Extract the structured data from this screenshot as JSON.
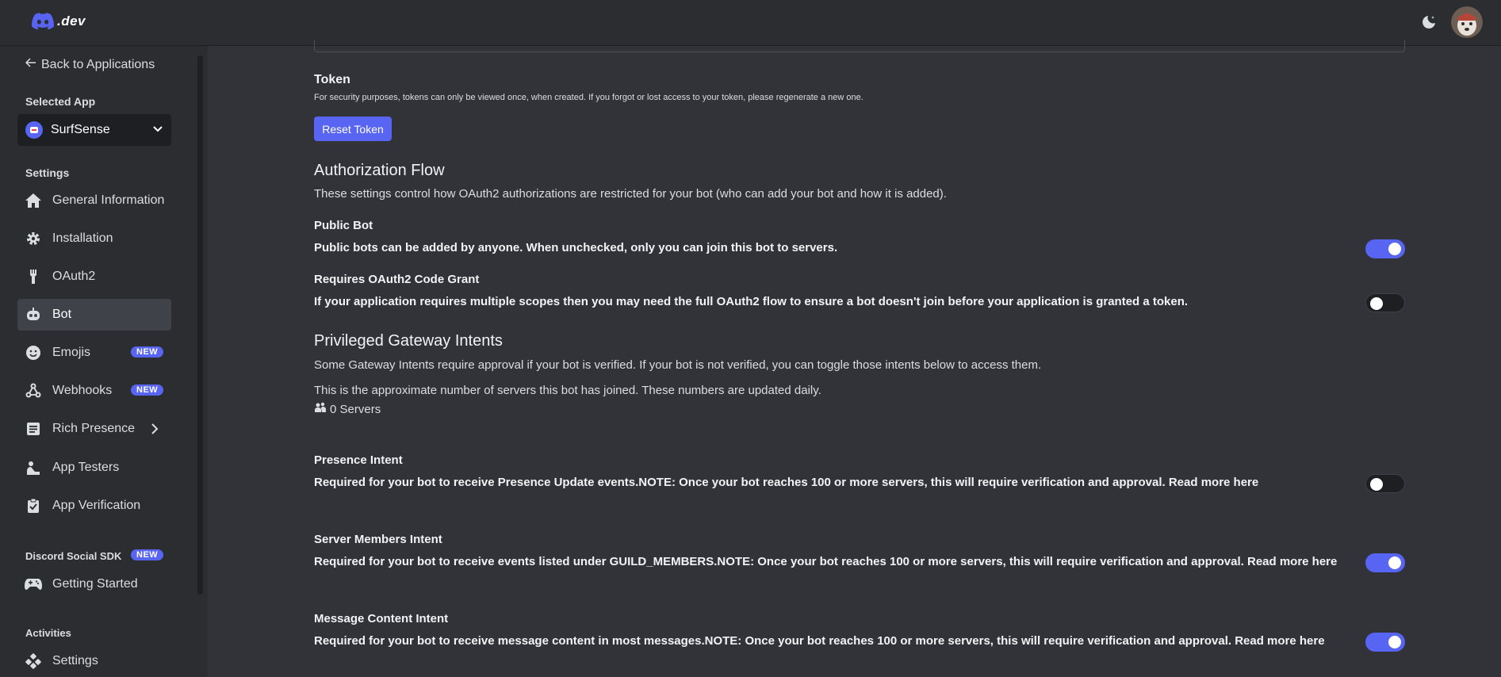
{
  "header": {
    "logo_text": ".dev",
    "theme_icon": "moon-star-icon",
    "avatar_icon": "user-avatar"
  },
  "sidebar": {
    "back_label": "Back to Applications",
    "selected_app_label": "Selected App",
    "selected_app_name": "SurfSense",
    "settings_label": "Settings",
    "items": [
      {
        "label": "General Information",
        "icon": "home-icon"
      },
      {
        "label": "Installation",
        "icon": "gear-icon"
      },
      {
        "label": "OAuth2",
        "icon": "wrench-icon"
      },
      {
        "label": "Bot",
        "icon": "robot-icon"
      },
      {
        "label": "Emojis",
        "icon": "smile-icon",
        "badge": "NEW"
      },
      {
        "label": "Webhooks",
        "icon": "webhook-icon",
        "badge": "NEW"
      },
      {
        "label": "Rich Presence",
        "icon": "document-icon"
      },
      {
        "label": "App Testers",
        "icon": "person-icon"
      },
      {
        "label": "App Verification",
        "icon": "clipboard-check-icon"
      }
    ],
    "social_sdk_label": "Discord Social SDK",
    "social_sdk_badge": "NEW",
    "getting_started_label": "Getting Started",
    "activities_label": "Activities",
    "activities_settings_label": "Settings"
  },
  "token": {
    "title": "Token",
    "description": "For security purposes, tokens can only be viewed once, when created. If you forgot or lost access to your token, please regenerate a new one.",
    "reset_button": "Reset Token"
  },
  "auth_flow": {
    "title": "Authorization Flow",
    "description": "These settings control how OAuth2 authorizations are restricted for your bot (who can add your bot and how it is added).",
    "public_bot": {
      "title": "Public Bot",
      "description": "Public bots can be added by anyone. When unchecked, only you can join this bot to servers.",
      "enabled": true
    },
    "code_grant": {
      "title": "Requires OAuth2 Code Grant",
      "description": "If your application requires multiple scopes then you may need the full OAuth2 flow to ensure a bot doesn't join before your application is granted a token.",
      "enabled": false
    }
  },
  "intents": {
    "title": "Privileged Gateway Intents",
    "description": "Some Gateway Intents require approval if your bot is verified. If your bot is not verified, you can toggle those intents below to access them.",
    "server_note": "This is the approximate number of servers this bot has joined. These numbers are updated daily.",
    "server_count": "0 Servers",
    "presence": {
      "title": "Presence Intent",
      "description": "Required for your bot to receive Presence Update events.NOTE: Once your bot reaches 100 or more servers, this will require verification and approval. Read more here",
      "enabled": false
    },
    "members": {
      "title": "Server Members Intent",
      "description": "Required for your bot to receive events listed under GUILD_MEMBERS.NOTE: Once your bot reaches 100 or more servers, this will require verification and approval. Read more here",
      "enabled": true
    },
    "message_content": {
      "title": "Message Content Intent",
      "description": "Required for your bot to receive message content in most messages.NOTE: Once your bot reaches 100 or more servers, this will require verification and approval. Read more here",
      "enabled": true
    }
  },
  "colors": {
    "accent": "#5865f2",
    "background": "#313338",
    "sidebar": "#2b2d31"
  }
}
